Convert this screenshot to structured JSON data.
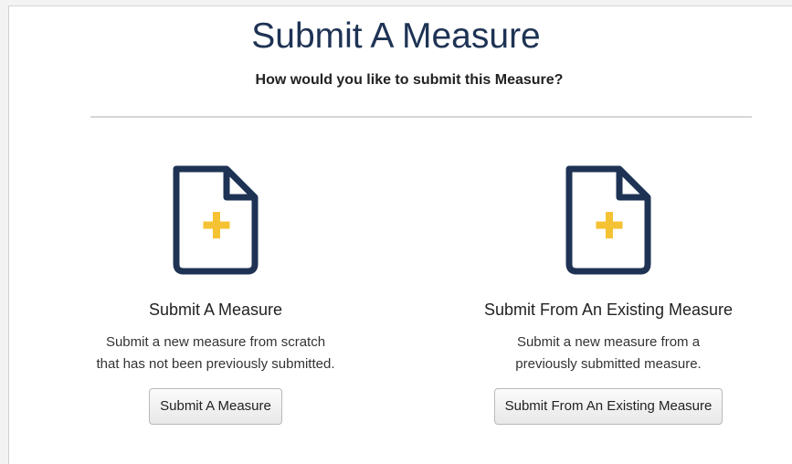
{
  "header": {
    "title": "Submit A Measure",
    "subtitle": "How would you like to submit this Measure?"
  },
  "options": [
    {
      "title": "Submit A Measure",
      "description_lines": [
        "Submit a new measure from scratch",
        "that has not been previously submitted."
      ],
      "button_label": "Submit A Measure",
      "icon": "file-plus-icon"
    },
    {
      "title": "Submit From An Existing Measure",
      "description_lines": [
        "Submit a new measure from a",
        "previously submitted measure."
      ],
      "button_label": "Submit From An Existing Measure",
      "icon": "file-plus-icon"
    }
  ],
  "colors": {
    "title": "#1e3354",
    "icon_stroke": "#1e3354",
    "icon_plus": "#f5c233",
    "divider": "#d6d6d6"
  }
}
